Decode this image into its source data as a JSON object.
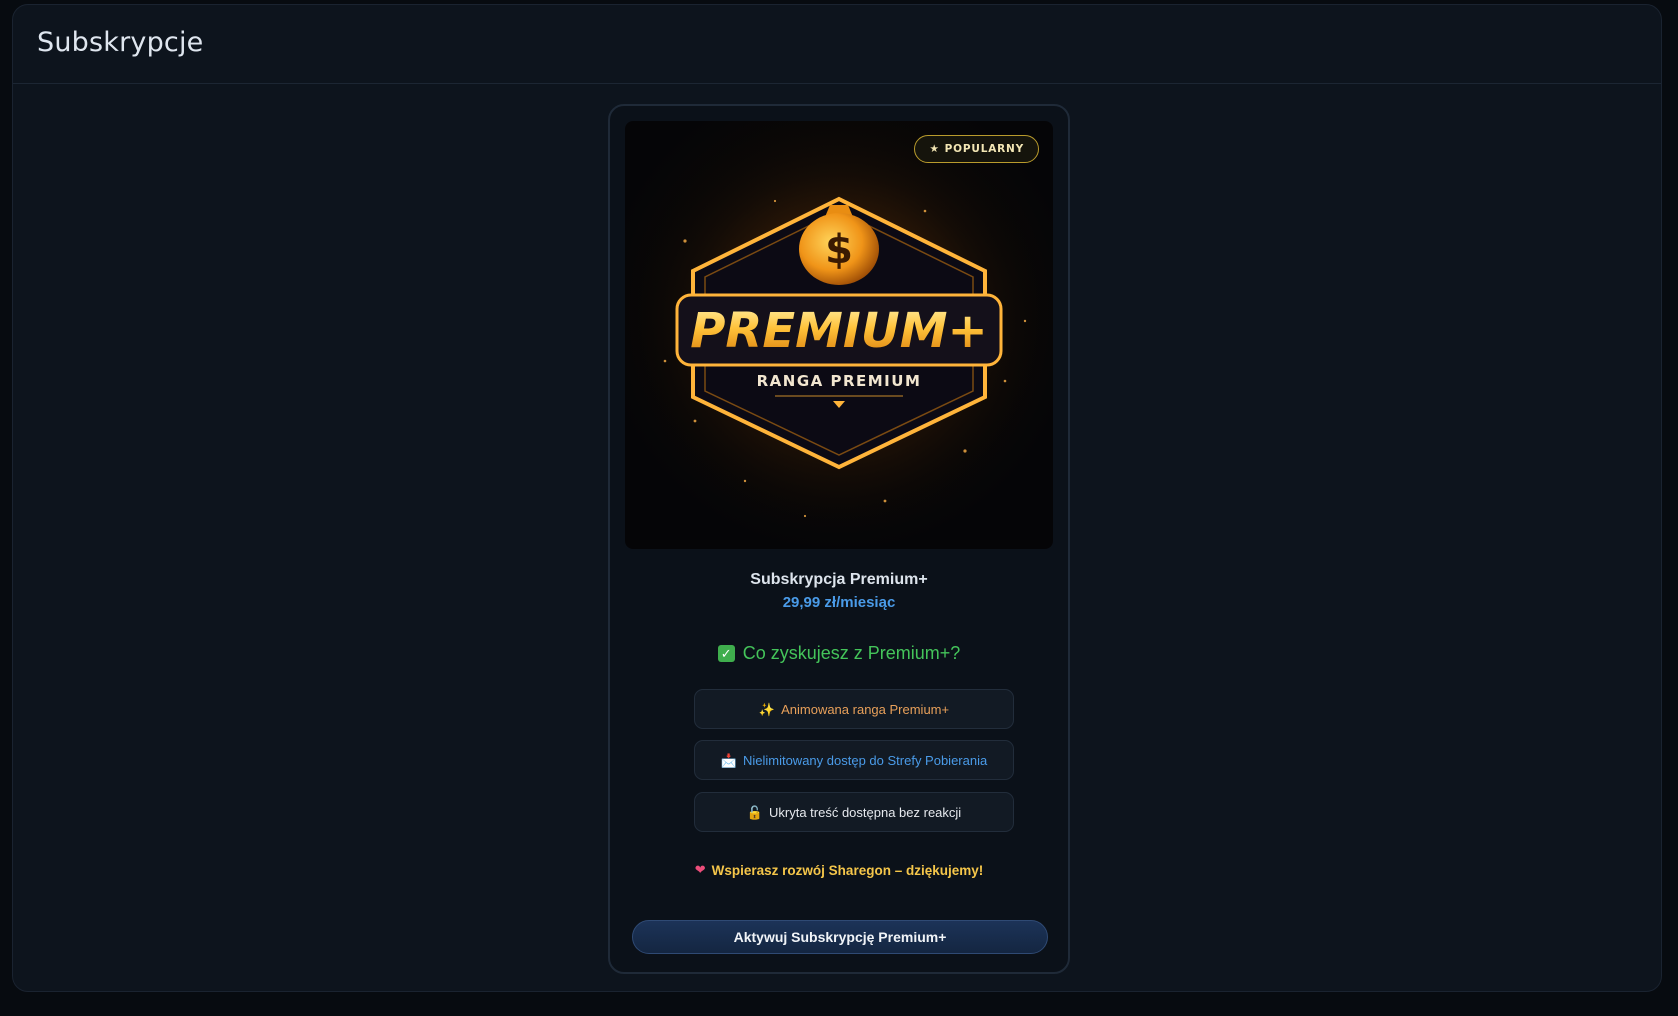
{
  "page": {
    "title": "Subskrypcje"
  },
  "card": {
    "badge": {
      "icon": "star-icon",
      "glyph": "★",
      "label": "POPULARNY"
    },
    "image": {
      "logo_text": "PREMIUM+",
      "subtitle": "RANGA PREMIUM",
      "bag_symbol": "$"
    },
    "name": "Subskrypcja Premium+",
    "price": "29,99 zł/miesiąc",
    "benefits_title": "Co zyskujesz z Premium+?",
    "features": [
      {
        "icon": "sparkles-icon",
        "glyph": "✨",
        "label": "Animowana ranga Premium+",
        "color": "#e8a05a"
      },
      {
        "icon": "inbox-icon",
        "glyph": "📩",
        "label": "Nielimitowany dostęp do Strefy Pobierania",
        "color": "#4a9be8"
      },
      {
        "icon": "unlock-icon",
        "glyph": "🔓",
        "label": "Ukryta treść dostępna bez reakcji",
        "color": "#e6e9ee"
      }
    ],
    "thanks": {
      "icon": "heart-icon",
      "glyph": "❤",
      "label": "Wspierasz rozwój Sharegon – dziękujemy!"
    },
    "cta_label": "Aktywuj Subskrypcję Premium+"
  },
  "colors": {
    "accent_blue": "#4a9be8",
    "success_green": "#44c45a",
    "gold": "#f5c64a",
    "background": "#0d141d"
  }
}
